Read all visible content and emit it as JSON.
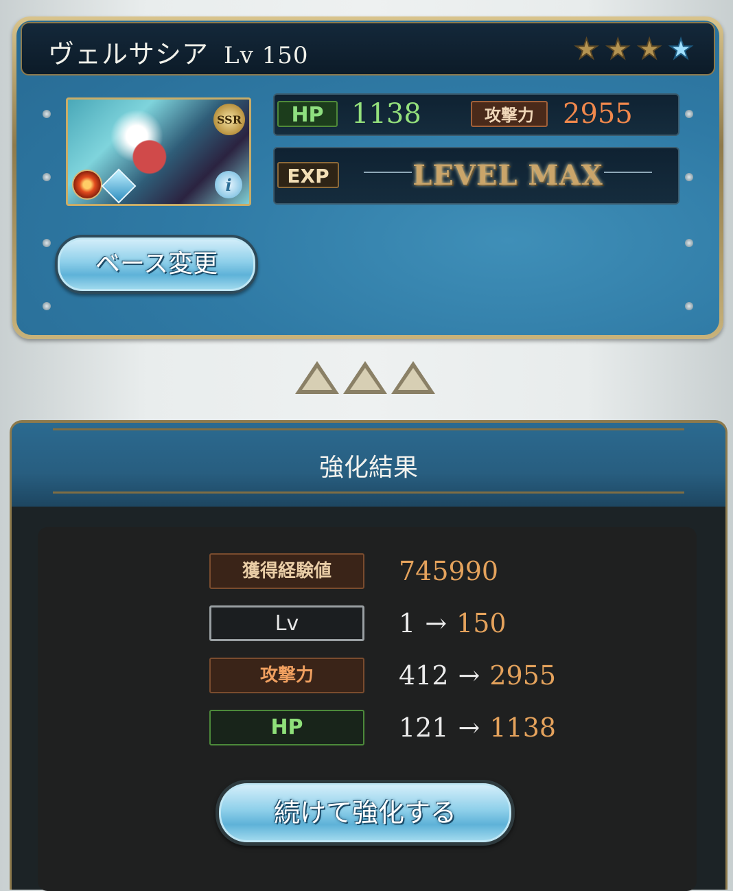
{
  "character": {
    "name": "ヴェルサシア",
    "level_label": "Lv 150",
    "rarity": "SSR",
    "stars_filled": 3,
    "stars_total": 4
  },
  "stats": {
    "hp_label": "HP",
    "hp_value": "1138",
    "atk_label": "攻撃力",
    "atk_value": "2955",
    "exp_label": "EXP",
    "exp_status": "LEVEL MAX"
  },
  "buttons": {
    "change_base": "ベース変更",
    "continue": "続けて強化する"
  },
  "result": {
    "title": "強化結果",
    "rows": [
      {
        "label": "獲得経験値",
        "from": "",
        "to": "745990"
      },
      {
        "label": "Lv",
        "from": "1",
        "to": "150"
      },
      {
        "label": "攻撃力",
        "from": "412",
        "to": "2955"
      },
      {
        "label": "HP",
        "from": "121",
        "to": "1138"
      }
    ],
    "arrow": "→"
  },
  "colors": {
    "hp": "#94e07c",
    "atk": "#f0884c",
    "result_value": "#e4a25c",
    "panel_blue": "#2f7aa5"
  },
  "icons": [
    "star-icon",
    "fire-element-icon",
    "type-icon",
    "info-icon",
    "up-arrow-icon"
  ]
}
